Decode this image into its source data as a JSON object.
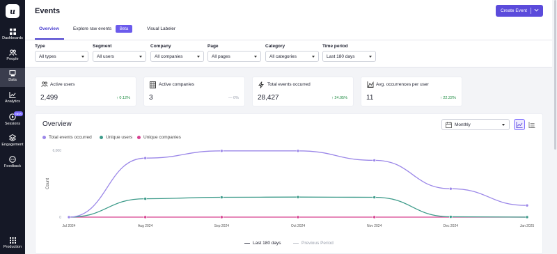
{
  "app": {
    "logo_letter": "u"
  },
  "sidebar": {
    "items": [
      {
        "label": "Dashboards",
        "icon": "dashboards-icon",
        "active": false
      },
      {
        "label": "People",
        "icon": "people-icon",
        "active": false
      },
      {
        "label": "Data",
        "icon": "data-icon",
        "active": true
      },
      {
        "label": "Analytics",
        "icon": "analytics-icon",
        "active": false
      },
      {
        "label": "Sessions",
        "icon": "sessions-icon",
        "active": false,
        "badge": "NEW"
      },
      {
        "label": "Engagement",
        "icon": "engagement-icon",
        "active": false
      },
      {
        "label": "Feedback",
        "icon": "feedback-icon",
        "active": false
      }
    ],
    "bottom": {
      "label": "Production",
      "icon": "apps-grid-icon"
    }
  },
  "header": {
    "title": "Events",
    "create_button": "Create Event",
    "tabs": [
      {
        "label": "Overview",
        "active": true
      },
      {
        "label": "Explore raw events",
        "active": false,
        "badge": "Beta"
      },
      {
        "label": "Visual Labeler",
        "active": false
      }
    ]
  },
  "filters": [
    {
      "label": "Type",
      "value": "All types"
    },
    {
      "label": "Segment",
      "value": "All users"
    },
    {
      "label": "Company",
      "value": "All companies"
    },
    {
      "label": "Page",
      "value": "All pages"
    },
    {
      "label": "Category",
      "value": "All categories"
    },
    {
      "label": "Time period",
      "value": "Last 180 days"
    }
  ],
  "stats": [
    {
      "title": "Active users",
      "icon": "users-icon",
      "value": "2,499",
      "trend": "0.12%",
      "direction": "up"
    },
    {
      "title": "Active companies",
      "icon": "building-icon",
      "value": "3",
      "trend": "0%",
      "direction": "flat"
    },
    {
      "title": "Total events occurred",
      "icon": "lightning-icon",
      "value": "28,427",
      "trend": "24.05%",
      "direction": "up"
    },
    {
      "title": "Avg. occurrences per user",
      "icon": "area-chart-icon",
      "value": "11",
      "trend": "22.22%",
      "direction": "up"
    }
  ],
  "overview": {
    "title": "Overview",
    "period": "Monthly",
    "legend": [
      {
        "label": "Total events occurred",
        "color": "#9b87e8"
      },
      {
        "label": "Unique users",
        "color": "#3d9b8a"
      },
      {
        "label": "Unique companies",
        "color": "#d6408f"
      }
    ],
    "bottom_legend": [
      {
        "label": "Last 180 days",
        "color": "#3a3d4d"
      },
      {
        "label": "Previous Period",
        "color": "#b9bcc6"
      }
    ]
  },
  "chart_data": {
    "type": "line",
    "x": [
      "Jul 2024",
      "Aug 2024",
      "Sep 2024",
      "Oct 2024",
      "Nov 2024",
      "Dec 2024",
      "Jan 2025"
    ],
    "series": [
      {
        "name": "Total events occurred",
        "color": "#9b87e8",
        "values": [
          0,
          5300,
          5950,
          5950,
          5100,
          2550,
          1050
        ]
      },
      {
        "name": "Unique users",
        "color": "#3d9b8a",
        "values": [
          0,
          1650,
          1780,
          1800,
          1780,
          30,
          0
        ]
      },
      {
        "name": "Unique companies",
        "color": "#d6408f",
        "values": [
          0,
          0,
          0,
          0,
          0,
          0,
          0
        ]
      }
    ],
    "yticks": [
      "0",
      "6,000"
    ],
    "ylabel": "Count",
    "ylim": [
      0,
      6000
    ],
    "legend": "top-left",
    "grid": false
  }
}
